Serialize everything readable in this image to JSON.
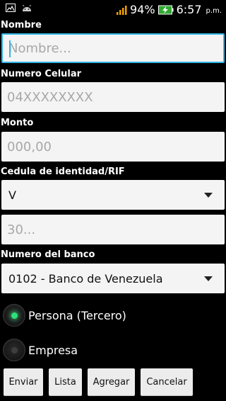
{
  "status_bar": {
    "battery": "94%",
    "time": "6:57",
    "ampm": "p.m.",
    "icons": [
      "image-icon",
      "android-icon",
      "signal-icon",
      "battery-charging-icon"
    ]
  },
  "form": {
    "nombre": {
      "label": "Nombre",
      "placeholder": "Nombre...",
      "value": ""
    },
    "celular": {
      "label": "Numero Celular",
      "placeholder": "04XXXXXXXX",
      "value": ""
    },
    "monto": {
      "label": "Monto",
      "placeholder": "000,00",
      "value": ""
    },
    "cedula": {
      "label": "Cedula de identidad/RIF",
      "type_selected": "V",
      "placeholder": "30...",
      "value": ""
    },
    "banco": {
      "label": "Numero del banco",
      "selected": "0102 - Banco de Venezuela"
    }
  },
  "radios": [
    {
      "label": "Persona (Tercero)",
      "checked": true
    },
    {
      "label": "Empresa",
      "checked": false
    }
  ],
  "buttons": {
    "enviar": "Enviar",
    "lista": "Lista",
    "agregar": "Agregar",
    "cancelar": "Cancelar"
  },
  "colors": {
    "accent": "#33b5e5",
    "radio_on": "#2fe07a"
  }
}
